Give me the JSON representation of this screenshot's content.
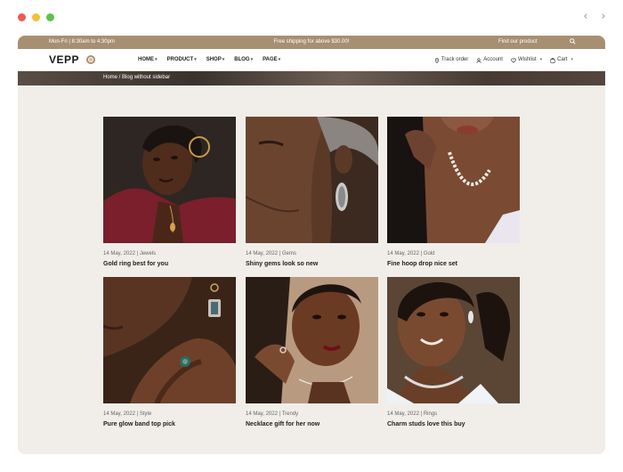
{
  "browser": {
    "back_glyph": "‹",
    "forward_glyph": "›"
  },
  "topbar": {
    "hours": "Mon-Fri | 8:30am to 4:30pm",
    "promo": "Free shipping for above $30.00!",
    "find": "Find our product",
    "icon": "search-icon"
  },
  "header": {
    "logo": "VEPP",
    "menu": [
      {
        "label": "HOME"
      },
      {
        "label": "PRODUCT"
      },
      {
        "label": "SHOP"
      },
      {
        "label": "BLOG"
      },
      {
        "label": "PAGE"
      }
    ],
    "actions": {
      "track": "Track order",
      "account": "Account",
      "wishlist": "Wishlist",
      "cart": "Cart"
    }
  },
  "breadcrumb": {
    "home": "Home",
    "separator": " / ",
    "current": "Blog without sidebar"
  },
  "posts": [
    {
      "date": "14 May, 2022",
      "category": "Jewels",
      "title": "Gold ring best for you"
    },
    {
      "date": "14 May, 2022",
      "category": "Gems",
      "title": "Shiny gems look so new"
    },
    {
      "date": "14 May, 2022",
      "category": "Gold",
      "title": "Fine hoop drop nice set"
    },
    {
      "date": "14 May, 2022",
      "category": "Style",
      "title": "Pure glow band top pick"
    },
    {
      "date": "14 May, 2022",
      "category": "Trendy",
      "title": "Necklace gift for her now"
    },
    {
      "date": "14 May, 2022",
      "category": "Rings",
      "title": "Charm studs love this buy"
    }
  ],
  "colors": {
    "topbar": "#a88f72",
    "page_bg": "#f1eeea",
    "accent": "#b08e6b"
  }
}
